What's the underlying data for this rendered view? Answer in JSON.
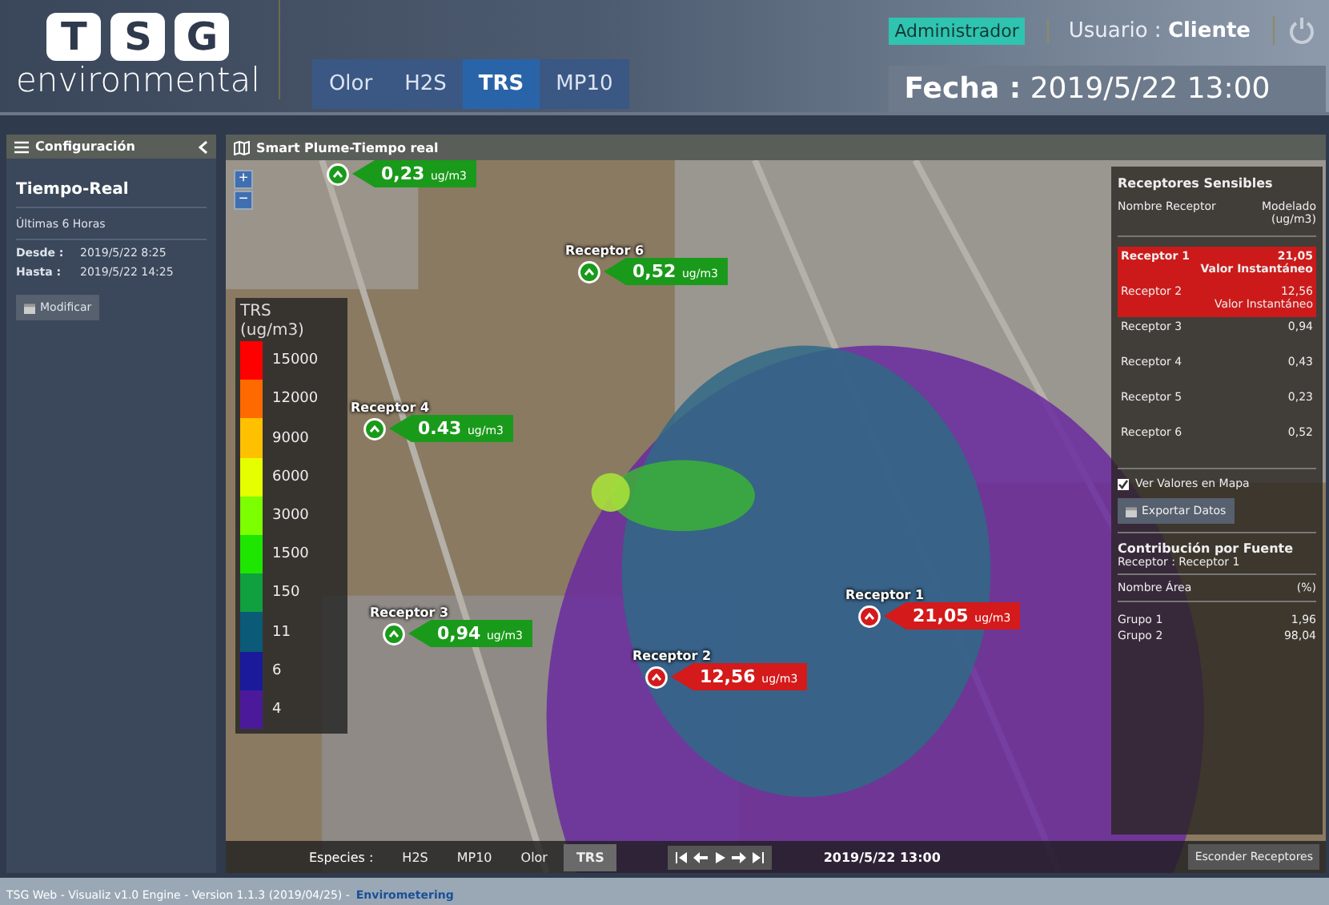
{
  "header": {
    "logo_letters": [
      "T",
      "S",
      "G"
    ],
    "wordmark": "environmental",
    "tabs": [
      {
        "label": "Olor",
        "selected": false
      },
      {
        "label": "H2S",
        "selected": false
      },
      {
        "label": "TRS",
        "selected": true
      },
      {
        "label": "MP10",
        "selected": false
      }
    ],
    "role_badge": "Administrador",
    "user_label": "Usuario :",
    "user_name": "Cliente",
    "date_label": "Fecha :",
    "date_value": "2019/5/22 13:00"
  },
  "sidebar": {
    "title": "Configuración",
    "mode": "Tiempo-Real",
    "range": "Últimas 6 Horas",
    "from_label": "Desde :",
    "from_value": "2019/5/22 8:25",
    "to_label": "Hasta :",
    "to_value": "2019/5/22 14:25",
    "button": "Modificar"
  },
  "map": {
    "title": "Smart Plume-Tiempo real",
    "zoom_in": "+",
    "zoom_out": "−",
    "legend": {
      "title": "TRS",
      "unit": "(ug/m3)",
      "bands": [
        {
          "label": "15000",
          "color": "#ff0000"
        },
        {
          "label": "12000",
          "color": "#ff6a00"
        },
        {
          "label": "9000",
          "color": "#ffc000"
        },
        {
          "label": "6000",
          "color": "#e6ff00"
        },
        {
          "label": "3000",
          "color": "#7cff00"
        },
        {
          "label": "1500",
          "color": "#1ee600"
        },
        {
          "label": "150",
          "color": "#10a040"
        },
        {
          "label": "11",
          "color": "#0a5a78"
        },
        {
          "label": "6",
          "color": "#1a1a9a"
        },
        {
          "label": "4",
          "color": "#4a1a9a"
        }
      ]
    },
    "markers": [
      {
        "value": "0,23",
        "unit": "ug/m3",
        "color": "#1a9a1a"
      },
      {
        "name": "Receptor 6",
        "value": "0,52",
        "unit": "ug/m3",
        "color": "#1a9a1a"
      },
      {
        "name": "Receptor 4",
        "value": "0.43",
        "unit": "ug/m3",
        "color": "#1a9a1a"
      },
      {
        "name": "Receptor 3",
        "value": "0,94",
        "unit": "ug/m3",
        "color": "#1a9a1a"
      },
      {
        "name": "Receptor 2",
        "value": "12,56",
        "unit": "ug/m3",
        "color": "#d41a1a"
      },
      {
        "name": "Receptor 1",
        "value": "21,05",
        "unit": "ug/m3",
        "color": "#d41a1a"
      }
    ],
    "receptors": {
      "title": "Receptores Sensibles",
      "col_name": "Nombre Receptor",
      "col_value": "Modelado (ug/m3)",
      "rows": [
        {
          "name": "Receptor 1",
          "value": "21,05",
          "note": "Valor Instantáneo",
          "alert": true,
          "selected": true
        },
        {
          "name": "Receptor 2",
          "value": "12,56",
          "note": "Valor Instantáneo",
          "alert": true,
          "selected": false
        },
        {
          "name": "Receptor 3",
          "value": "0,94",
          "alert": false,
          "selected": false
        },
        {
          "name": "Receptor 4",
          "value": "0,43",
          "alert": false,
          "selected": false
        },
        {
          "name": "Receptor 5",
          "value": "0,23",
          "alert": false,
          "selected": false
        },
        {
          "name": "Receptor 6",
          "value": "0,52",
          "alert": false,
          "selected": false
        }
      ],
      "checkbox": {
        "label": "Ver Valores en Mapa",
        "checked": true
      },
      "export_button": "Exportar Datos",
      "contribution": {
        "title": "Contribución por Fuente",
        "receptor": "Receptor : Receptor 1",
        "col_name": "Nombre Área",
        "col_value": "(%)",
        "rows": [
          {
            "name": "Grupo 1",
            "value": "1,96"
          },
          {
            "name": "Grupo 2",
            "value": "98,04"
          }
        ]
      }
    },
    "bottom_bar": {
      "species_label": "Especies :",
      "species": [
        {
          "label": "H2S",
          "selected": false
        },
        {
          "label": "MP10",
          "selected": false
        },
        {
          "label": "Olor",
          "selected": false
        },
        {
          "label": "TRS",
          "selected": true
        }
      ],
      "time": "2019/5/22 13:00",
      "hide_button": "Esconder Receptores"
    }
  },
  "footer": {
    "text": "TSG Web - Visualiz v1.0 Engine - Version 1.1.3 (2019/04/25) -",
    "link": "Envirometering"
  }
}
